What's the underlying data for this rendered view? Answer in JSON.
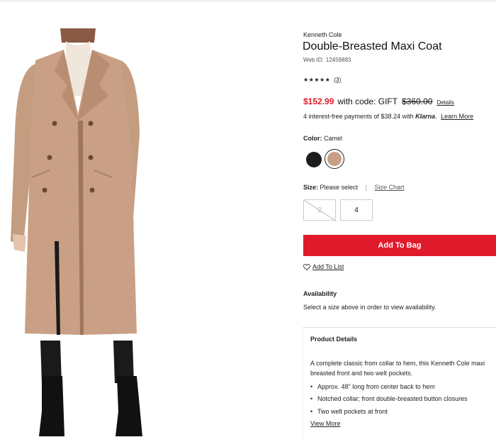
{
  "product": {
    "brand": "Kenneth Cole",
    "title": "Double-Breasted Maxi Coat",
    "web_id_label": "Web ID:",
    "web_id": "12459883",
    "rating_stars": "★★★★★",
    "rating_value": 4.5,
    "review_count": "(3)",
    "image_alt": "Woman wearing camel double-breasted maxi coat"
  },
  "pricing": {
    "sale_price": "$152.99",
    "with_code": "with code: GIFT",
    "original_price": "$360.00",
    "details_link": "Details",
    "sale_color": "#e11a2b"
  },
  "klarna": {
    "text": "4 interest-free payments of $38.24 with",
    "brand": "Klarna",
    "period": ".",
    "learn_more": "Learn More"
  },
  "color": {
    "label": "Color:",
    "selected": "Camel",
    "swatches": [
      {
        "name": "Black",
        "hex": "#1d1d1d"
      },
      {
        "name": "Camel",
        "hex": "#c9a085",
        "selected": true
      }
    ]
  },
  "size": {
    "label": "Size:",
    "prompt": "Please select",
    "separator": "|",
    "size_chart": "Size Chart",
    "options": [
      {
        "value": "2",
        "available": false
      },
      {
        "value": "4",
        "available": true
      }
    ]
  },
  "actions": {
    "add_to_bag": "Add To Bag",
    "add_to_list": "Add To List"
  },
  "availability": {
    "title": "Availability",
    "text": "Select a size above in order to view availability."
  },
  "product_details": {
    "title": "Product Details",
    "description": "A complete classic from collar to hem, this Kenneth Cole maxi breasted front and two welt pockets.",
    "bullets": [
      "Approx. 48\" long from center back to hem",
      "Notched collar; front double-breasted button closures",
      "Two welt pockets at front"
    ],
    "view_more": "View More"
  }
}
